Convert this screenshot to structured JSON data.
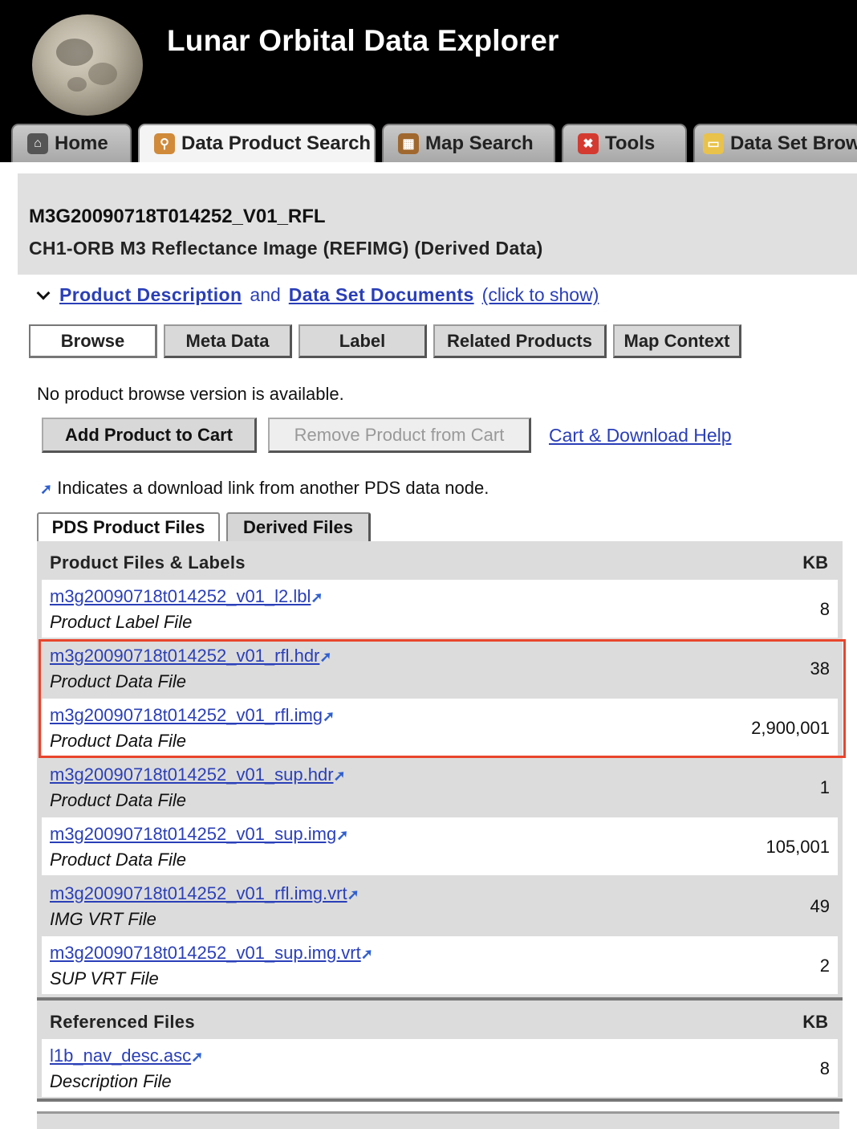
{
  "app": {
    "title": "Lunar Orbital Data Explorer"
  },
  "nav": {
    "tabs": [
      {
        "label": "Home",
        "icon": "home-icon"
      },
      {
        "label": "Data Product Search",
        "icon": "search-icon",
        "active": true
      },
      {
        "label": "Map Search",
        "icon": "map-icon"
      },
      {
        "label": "Tools",
        "icon": "tools-icon"
      },
      {
        "label": "Data Set Brow",
        "icon": "folder-icon"
      }
    ]
  },
  "product": {
    "id": "M3G20090718T014252_V01_RFL",
    "description": "CH1-ORB M3 Reflectance Image (REFIMG) (Derived Data)"
  },
  "docs": {
    "part1": "Product Description",
    "and": "and",
    "part2": "Data Set Documents",
    "hint": "(click to show)"
  },
  "product_tabs": [
    "Browse",
    "Meta Data",
    "Label",
    "Related Products",
    "Map Context"
  ],
  "browse": {
    "message": "No product browse version is available."
  },
  "cart": {
    "add_label": "Add Product to Cart",
    "remove_label": "Remove Product from Cart",
    "help_label": "Cart & Download Help"
  },
  "legend": {
    "text": "Indicates a download link from another PDS data node."
  },
  "file_tabs": [
    "PDS Product Files",
    "Derived Files"
  ],
  "product_files": {
    "heading": "Product Files & Labels",
    "kb_heading": "KB",
    "rows": [
      {
        "name": "m3g20090718t014252_v01_l2.lbl",
        "type": "Product Label File",
        "size": "8"
      },
      {
        "name": "m3g20090718t014252_v01_rfl.hdr",
        "type": "Product Data File",
        "size": "38"
      },
      {
        "name": "m3g20090718t014252_v01_rfl.img",
        "type": "Product Data File",
        "size": "2,900,001"
      },
      {
        "name": "m3g20090718t014252_v01_sup.hdr",
        "type": "Product Data File",
        "size": "1"
      },
      {
        "name": "m3g20090718t014252_v01_sup.img",
        "type": "Product Data File",
        "size": "105,001"
      },
      {
        "name": "m3g20090718t014252_v01_rfl.img.vrt",
        "type": "IMG VRT File",
        "size": "49"
      },
      {
        "name": "m3g20090718t014252_v01_sup.img.vrt",
        "type": "SUP VRT File",
        "size": "2"
      }
    ]
  },
  "referenced_files": {
    "heading": "Referenced Files",
    "kb_heading": "KB",
    "rows": [
      {
        "name": "l1b_nav_desc.asc",
        "type": "Description File",
        "size": "8"
      }
    ]
  },
  "colors": {
    "link": "#2a3fb8",
    "highlight": "#e8452c",
    "header_bg": "#000000"
  }
}
